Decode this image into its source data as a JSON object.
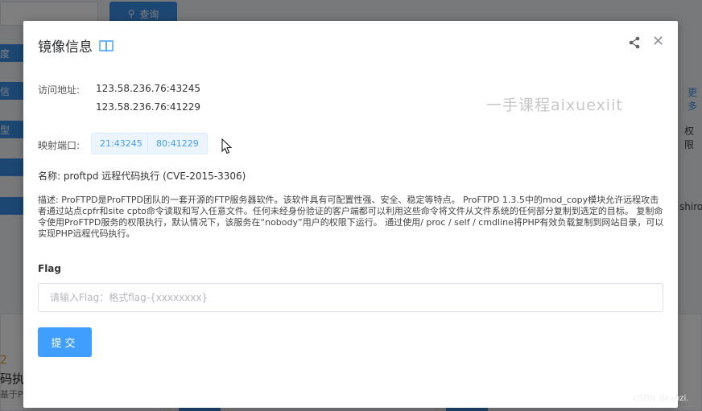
{
  "background": {
    "search_button": "查询",
    "side_tags": [
      "度",
      "信",
      "型",
      "",
      ""
    ],
    "right_more": "更多",
    "right_text_1": "权限",
    "right_text_2": "shiro",
    "lower_num": "2",
    "lower_title": "码执行",
    "lower_sub": "基于PH"
  },
  "dialog": {
    "title": "镜像信息",
    "watermark": "一手课程aixuexiit",
    "access_label": "访问地址:",
    "access_addresses": [
      "123.58.236.76:43245",
      "123.58.236.76:41229"
    ],
    "port_label": "映射端口:",
    "ports": [
      "21:43245",
      "80:41229"
    ],
    "name_line": "名称: proftpd 远程代码执行 (CVE-2015-3306)",
    "description": "描述: ProFTPD是ProFTPD团队的一套开源的FTP服务器软件。该软件具有可配置性强、安全、稳定等特点。 ProFTPD 1.3.5中的mod_copy模块允许远程攻击者通过站点cpfr和site cpto命令读取和写入任意文件。任何未经身份验证的客户端都可以利用这些命令将文件从文件系统的任何部分复制到选定的目标。 复制命令使用ProFTPD服务的权限执行，默认情况下，该服务在“nobody”用户的权限下运行。 通过使用/ proc / self / cmdline将PHP有效负载复制到网站目录，可以实现PHP远程代码执行。",
    "flag_label": "Flag",
    "flag_placeholder": "请输入Flag：格式flag-{xxxxxxxx}",
    "flag_value": "",
    "submit_label": "提交"
  },
  "footer_watermark": "CSDN @ranzi.",
  "colors": {
    "primary": "#409eff",
    "overlay": "rgba(0,0,0,0.5)"
  }
}
